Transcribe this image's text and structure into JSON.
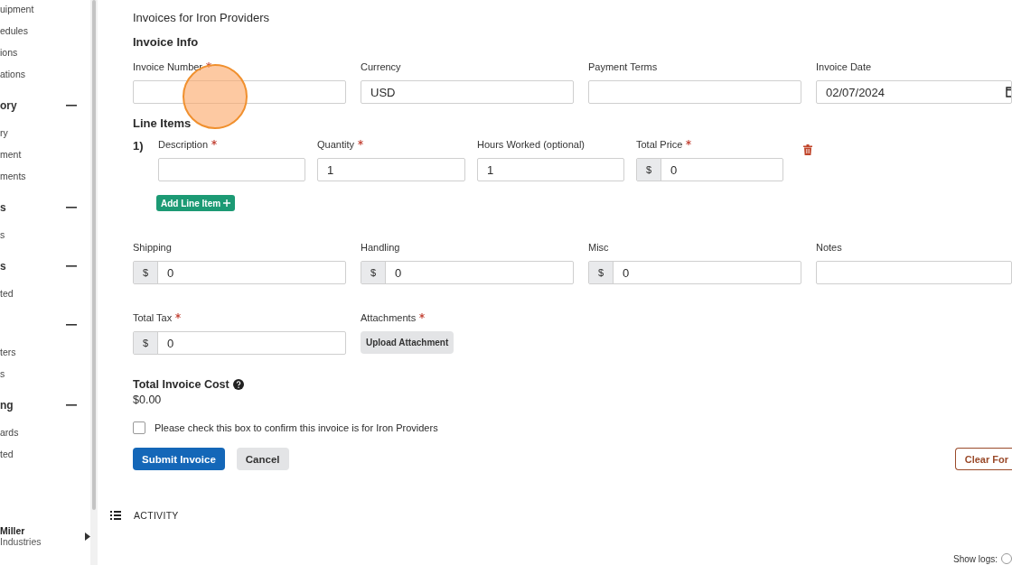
{
  "sidebar": {
    "groups": [
      {
        "items": [
          {
            "label": "uipment"
          },
          {
            "label": "edules"
          },
          {
            "label": "ions"
          },
          {
            "label": "ations"
          }
        ]
      },
      {
        "title": "ory",
        "expanded": true,
        "items": [
          {
            "label": "ry"
          },
          {
            "label": "ment"
          },
          {
            "label": "ments"
          }
        ]
      },
      {
        "title": "s",
        "expanded": true,
        "items": [
          {
            "label": "s"
          }
        ]
      },
      {
        "title": "s",
        "expanded": true,
        "items": [
          {
            "label": "ted"
          }
        ]
      },
      {
        "expanded": true,
        "items": [
          {
            "label": "ters"
          },
          {
            "label": "s"
          }
        ]
      },
      {
        "title": "ng",
        "expanded": true,
        "items": [
          {
            "label": "ards"
          },
          {
            "label": "ted"
          }
        ]
      }
    ],
    "user": {
      "name": "Miller",
      "company": "Industries"
    }
  },
  "page_title": "Invoices for Iron Providers",
  "invoice_info": {
    "heading": "Invoice Info",
    "fields": [
      {
        "kind": "text",
        "label": "Invoice Number",
        "required": true
      },
      {
        "kind": "text",
        "label": "Currency",
        "required": false,
        "value": "USD"
      },
      {
        "kind": "text",
        "label": "Payment Terms",
        "required": false
      },
      {
        "kind": "date",
        "label": "Invoice Date",
        "required": false,
        "value": "02/07/2024"
      }
    ]
  },
  "line_items": {
    "heading": "Line Items",
    "items": [
      {
        "number": "1)",
        "fields": [
          {
            "kind": "text",
            "label": "Description",
            "required": true
          },
          {
            "kind": "text",
            "label": "Quantity",
            "required": true,
            "value": "1"
          },
          {
            "kind": "text",
            "label": "Hours Worked (optional)",
            "required": false,
            "value": "1"
          },
          {
            "kind": "money",
            "label": "Total Price",
            "required": true,
            "prefix": "$",
            "value": "0"
          }
        ]
      }
    ],
    "add_button": "Add Line Item"
  },
  "charges": [
    {
      "kind": "money",
      "label": "Shipping",
      "required": false,
      "prefix": "$",
      "value": "0"
    },
    {
      "kind": "money",
      "label": "Handling",
      "required": false,
      "prefix": "$",
      "value": "0"
    },
    {
      "kind": "money",
      "label": "Misc",
      "required": false,
      "prefix": "$",
      "value": "0"
    },
    {
      "kind": "text",
      "label": "Notes",
      "required": false
    }
  ],
  "tax_and_attachments": [
    {
      "kind": "money",
      "label": "Total Tax",
      "required": true,
      "prefix": "$",
      "value": "0"
    },
    {
      "kind": "upload",
      "label": "Attachments",
      "required": true,
      "button": "Upload Attachment"
    }
  ],
  "total": {
    "label": "Total Invoice Cost",
    "value": "$0.00"
  },
  "confirm": {
    "label": "Please check this box to confirm this invoice is for Iron Providers",
    "checked": false
  },
  "actions": {
    "submit": "Submit Invoice",
    "cancel": "Cancel",
    "clear": "Clear For"
  },
  "activity": {
    "label": "ACTIVITY",
    "show_logs": "Show logs:"
  }
}
